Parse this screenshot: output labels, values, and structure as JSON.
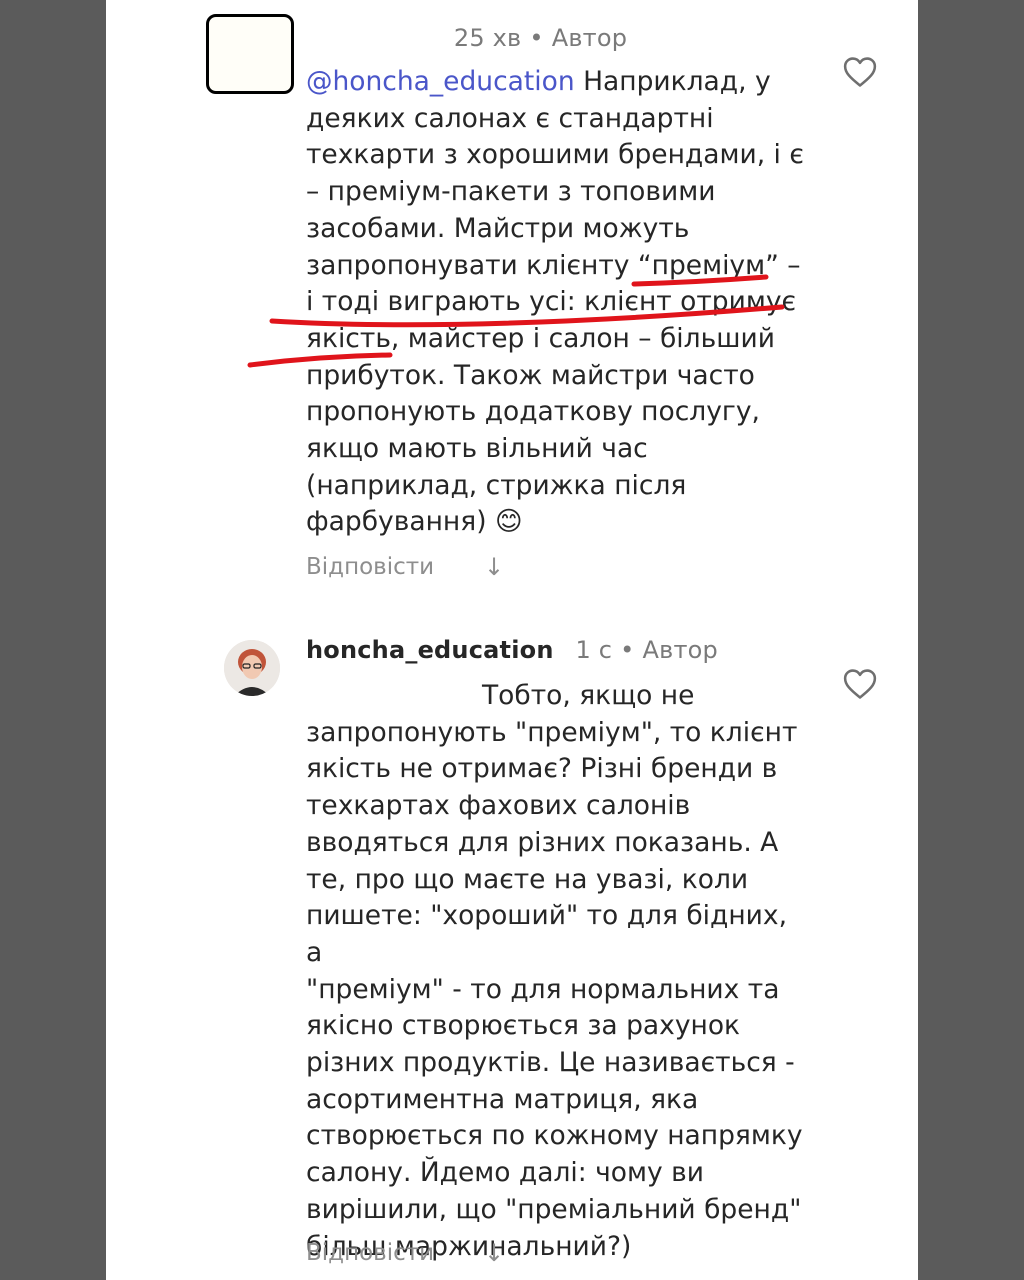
{
  "comments": [
    {
      "username": "",
      "time": "25 хв",
      "author_tag": "Автор",
      "mention": "@honcha_education",
      "text": " Наприклад, у\nдеяких салонах є стандартні\nтехкарти з хорошими брендами, і є\n– преміум-пакети з топовими\nзасобами. Майстри можуть\nзапропонувати клієнту “преміум” –\nі тоді виграють усі: клієнт отримує\nякість, майстер і салон – більший\nприбуток. Також майстри часто\nпропонують додаткову послугу,\nякщо мають вільний час\n(наприклад, стрижка після\nфарбування) 😊",
      "reply_label": "Відповісти",
      "reply_arrow": "↓",
      "like_icon": "heart-outline-icon"
    },
    {
      "username": "honcha_education",
      "time": "1 с",
      "author_tag": "Автор",
      "text": "Тобто, якщо не\nзапропонують \"преміум\", то клієнт\nякість не отримає? Різні бренди в\nтехкартах фахових салонів\nвводяться для різних показань. А\nте, про що маєте на увазі, коли\nпишете: \"хороший\" то для бідних, а\n\"преміум\" - то для нормальних та\nякісно створюється за рахунок\nрізних продуктів. Це називається -\nасортиментна матриця, яка\nстворюється по кожному напрямку\nсалону. Йдемо далі: чому ви\nвирішили, що \"преміальний бренд\"\nбільш маржинальний?)",
      "reply_label": "Відповісти",
      "reply_arrow": "↓",
      "like_icon": "heart-outline-icon"
    }
  ],
  "colors": {
    "background": "#5b5b5b",
    "panel": "#ffffff",
    "text": "#262626",
    "muted": "#8e8e8e",
    "mention": "#4a56c9",
    "annotation": "#e0141b"
  }
}
